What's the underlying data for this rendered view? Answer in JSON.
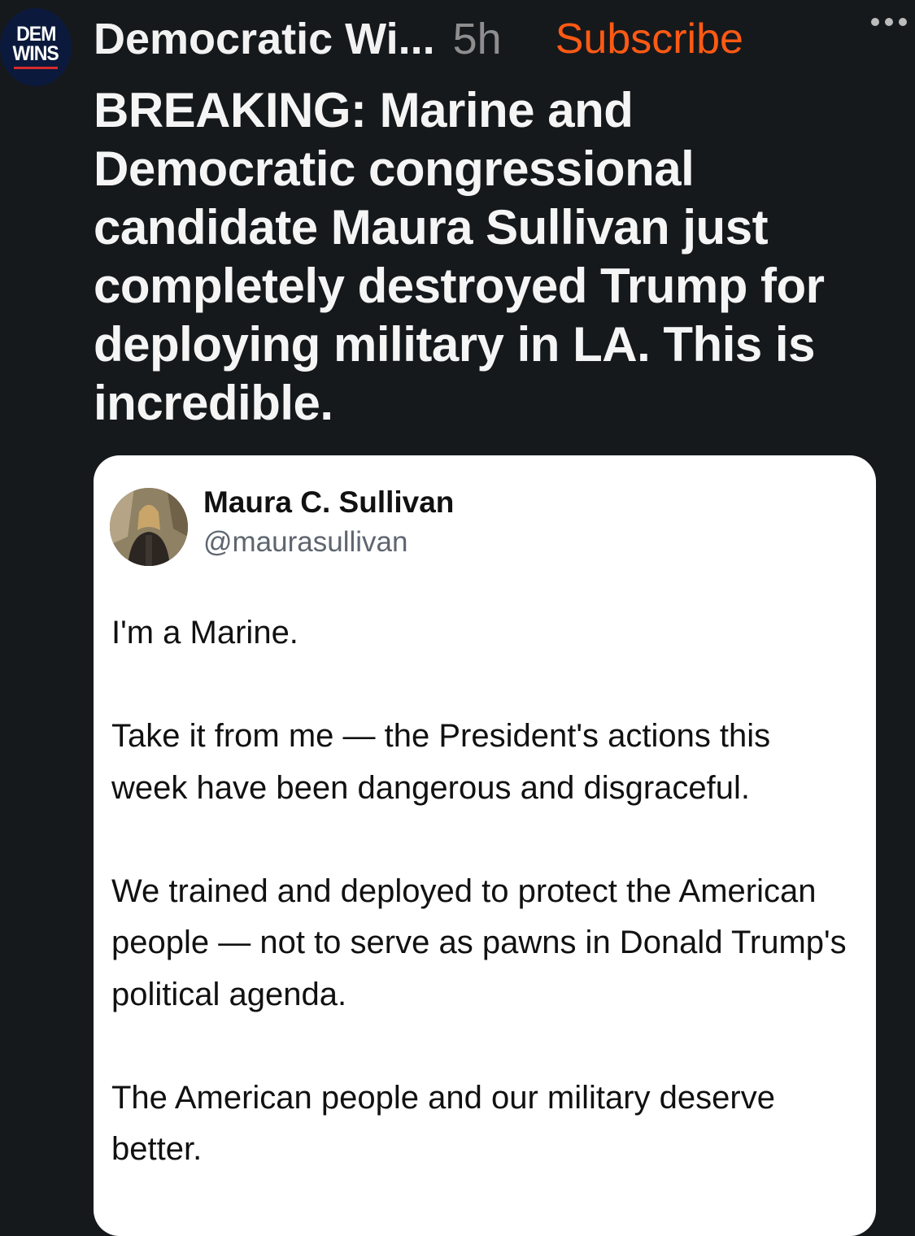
{
  "source_avatar": {
    "line1": "DEM",
    "line2": "WINS"
  },
  "header": {
    "name": "Democratic Wi...",
    "time": "5h",
    "subscribe_label": "Subscribe"
  },
  "post": {
    "headline": "BREAKING: Marine and Democratic congressional candidate Maura Sullivan just completely destroyed Trump for deploying military in LA. This is incredible."
  },
  "embedded_post": {
    "author_name": "Maura C. Sullivan",
    "author_handle": "@maurasullivan",
    "paragraphs": [
      "I'm a Marine.",
      "Take it from me — the President's actions this week have been dangerous and disgraceful.",
      "We trained and deployed to protect the American people — not to serve as pawns in Donald Trump's political agenda.",
      "The American people and our military deserve better."
    ]
  },
  "colors": {
    "background": "#16191c",
    "accent": "#ff5a14",
    "card": "#ffffff"
  }
}
